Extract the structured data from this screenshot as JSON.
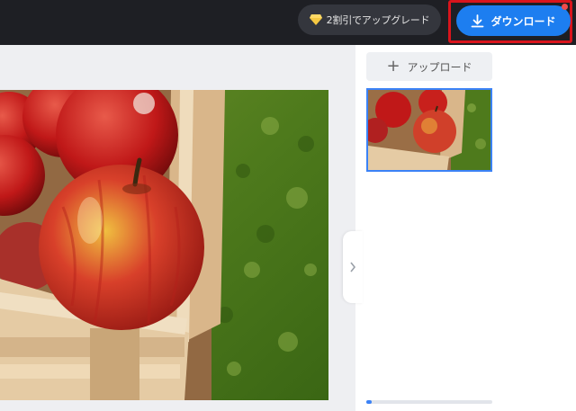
{
  "header": {
    "upgrade_label": "2割引でアップグレード",
    "download_label": "ダウンロード"
  },
  "sidebar": {
    "upload_label": "アップロード"
  },
  "colors": {
    "topbar": "#1e1f24",
    "accent": "#1d7ef0",
    "highlight_border": "#d9141c",
    "selection": "#3b82f6"
  },
  "icons": [
    "gem-icon",
    "download-icon",
    "plus-icon",
    "chevron-right-icon"
  ]
}
